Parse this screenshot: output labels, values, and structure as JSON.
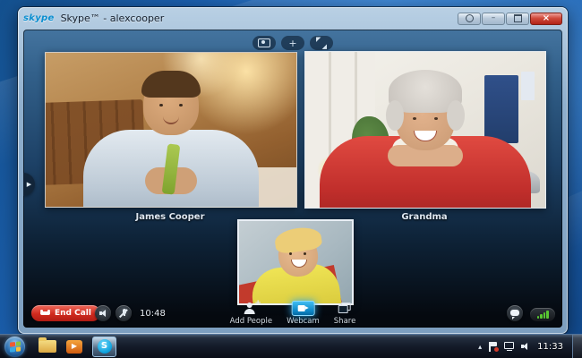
{
  "window": {
    "logo_text": "skype",
    "title": "Skype™ - alexcooper",
    "icons": {
      "minimize_glyph": "–",
      "close_glyph": "×",
      "plus_glyph": "+",
      "arrow_tab_glyph": "▶"
    }
  },
  "call": {
    "participants": [
      {
        "name": "James Cooper"
      },
      {
        "name": "Grandma"
      }
    ],
    "toolbar": {
      "end_call": "End Call",
      "duration": "10:48",
      "add_people": "Add People",
      "webcam": "Webcam",
      "share": "Share"
    }
  },
  "taskbar": {
    "media_play_glyph": "▶",
    "skype_s_glyph": "S",
    "tray_up_glyph": "▴",
    "clock": "11:33"
  },
  "colors": {
    "desktop_blue": "#2a77cc",
    "skype_brand_blue": "#0ba0dc",
    "end_call_red": "#d02a1e",
    "webcam_active_blue": "#1fa6e8",
    "signal_green": "#58c832"
  }
}
